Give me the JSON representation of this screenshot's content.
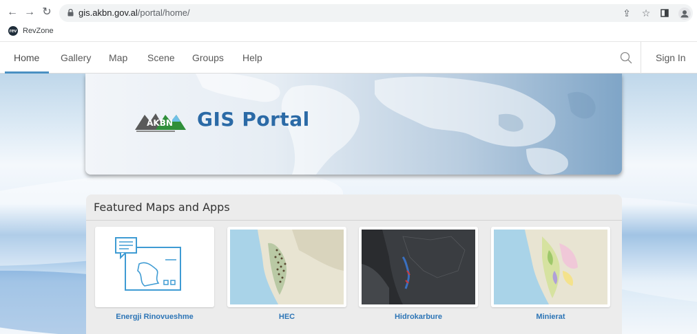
{
  "browser": {
    "url_host": "gis.akbn.gov.al",
    "url_path": "/portal/home/",
    "bookmark_label": "RevZone",
    "bookmark_icon_text": "rev"
  },
  "nav": {
    "tabs": [
      "Home",
      "Gallery",
      "Map",
      "Scene",
      "Groups",
      "Help"
    ],
    "active_tab": "Home",
    "sign_in": "Sign In"
  },
  "banner": {
    "logo_text": "AKBN",
    "title": "GIS Portal"
  },
  "featured": {
    "title": "Featured Maps and Apps",
    "items": [
      {
        "label": "Energji Rinovueshme"
      },
      {
        "label": "HEC"
      },
      {
        "label": "Hidrokarbure"
      },
      {
        "label": "Minierat"
      }
    ]
  },
  "colors": {
    "accent": "#4a90c2",
    "title_blue": "#2b6aa6",
    "link_blue": "#2d75b6"
  }
}
